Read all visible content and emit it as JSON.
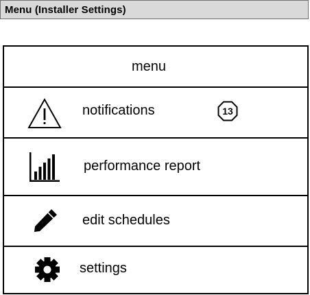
{
  "window": {
    "title": "Menu (Installer Settings)"
  },
  "menu": {
    "header": "menu",
    "items": [
      {
        "label": "notifications",
        "icon": "warning-icon",
        "badge": "13"
      },
      {
        "label": "performance report",
        "icon": "bar-chart-icon"
      },
      {
        "label": "edit schedules",
        "icon": "pencil-icon"
      },
      {
        "label": "settings",
        "icon": "gear-icon"
      }
    ]
  }
}
